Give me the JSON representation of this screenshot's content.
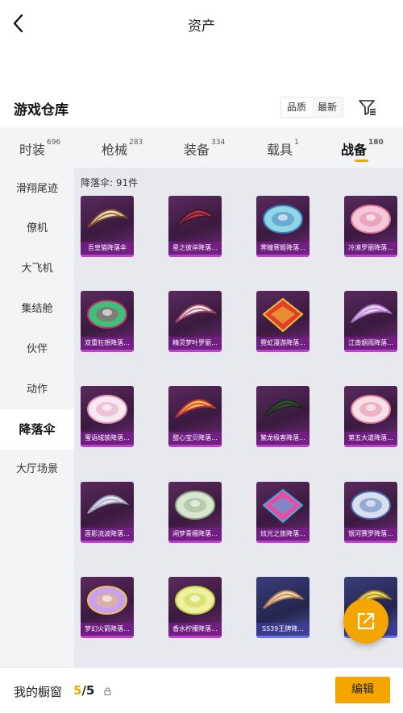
{
  "header": {
    "title": "资产"
  },
  "section": {
    "title": "游戏仓库",
    "sort_options": [
      "品质",
      "最新"
    ]
  },
  "tabs": [
    {
      "label": "时装",
      "count": "696"
    },
    {
      "label": "枪械",
      "count": "283"
    },
    {
      "label": "装备",
      "count": "334"
    },
    {
      "label": "载具",
      "count": "1"
    },
    {
      "label": "战备",
      "count": "180"
    }
  ],
  "sidebar": {
    "items": [
      {
        "label": "滑翔尾迹"
      },
      {
        "label": "僚机"
      },
      {
        "label": "大飞机"
      },
      {
        "label": "集结舱"
      },
      {
        "label": "伙伴"
      },
      {
        "label": "动作"
      },
      {
        "label": "降落伞"
      },
      {
        "label": "大厅场景"
      }
    ]
  },
  "content": {
    "count_label": "降落伞: 91件",
    "items": [
      {
        "name": "吾皇猫降落伞",
        "c1": "#f0e0c0",
        "c2": "#7a4a2a",
        "shape": "wing"
      },
      {
        "name": "星之彼岸降落...",
        "c1": "#c0304a",
        "c2": "#3a1a2a",
        "shape": "wing"
      },
      {
        "name": "霁瞳寒姬降落...",
        "c1": "#8fd6e8",
        "c2": "#3a7ab8",
        "shape": "dome"
      },
      {
        "name": "冷漠罗丽降落...",
        "c1": "#f4c8d8",
        "c2": "#e07aa0",
        "shape": "dome"
      },
      {
        "name": "双重狂想降落...",
        "c1": "#3ec07a",
        "c2": "#c0306a",
        "shape": "dome"
      },
      {
        "name": "精灵梦叶罗丽...",
        "c1": "#f0f0f0",
        "c2": "#a04a6a",
        "shape": "wing"
      },
      {
        "name": "霓虹漫游降落...",
        "c1": "#e0402a",
        "c2": "#f0c03a",
        "shape": "kite"
      },
      {
        "name": "江南烟雨降落...",
        "c1": "#e8d8f0",
        "c2": "#b07ad0",
        "shape": "wing"
      },
      {
        "name": "蜜语绒装降落...",
        "c1": "#f8e8f0",
        "c2": "#e09ab8",
        "shape": "dome"
      },
      {
        "name": "甜心宝贝降落...",
        "c1": "#f0c050",
        "c2": "#c03030",
        "shape": "wing"
      },
      {
        "name": "繁龙极客降落...",
        "c1": "#3a4a3a",
        "c2": "#1a2a1a",
        "shape": "wing"
      },
      {
        "name": "第五大道降落...",
        "c1": "#f8e0e8",
        "c2": "#e07a98",
        "shape": "dome"
      },
      {
        "name": "莲影流波降落...",
        "c1": "#e8e8f0",
        "c2": "#a0a0b8",
        "shape": "wing"
      },
      {
        "name": "闲梦青檀降落...",
        "c1": "#d8e8d0",
        "c2": "#8aa880",
        "shape": "dome"
      },
      {
        "name": "炫光之旅降落...",
        "c1": "#f04aa0",
        "c2": "#3ab0e0",
        "shape": "kite"
      },
      {
        "name": "银河赛罗降落...",
        "c1": "#d8e0f0",
        "c2": "#4a6ab0",
        "shape": "dome"
      },
      {
        "name": "梦幻火箭降落...",
        "c1": "#c8a0f0",
        "c2": "#f0c050",
        "shape": "dome"
      },
      {
        "name": "香水柠檬降落...",
        "c1": "#f0f0a0",
        "c2": "#c0d040",
        "shape": "dome"
      },
      {
        "name": "SS39王牌降...",
        "c1": "#f0d8b0",
        "c2": "#b08050",
        "shape": "wing",
        "blue": true
      },
      {
        "name": "",
        "c1": "#f0e060",
        "c2": "#a08030",
        "shape": "wing",
        "blue": true
      }
    ]
  },
  "bottom": {
    "shelf_label": "我的橱窗",
    "shelf_used": "5",
    "shelf_total": "/5",
    "edit_label": "编辑"
  },
  "icons": {
    "back": "chevron-left-icon",
    "filter": "funnel-icon",
    "share": "share-external-icon",
    "lock": "lock-icon"
  },
  "colors": {
    "accent": "#f5a500",
    "rarity_purple": "#c23fd3",
    "rarity_blue": "#6e74e6"
  }
}
